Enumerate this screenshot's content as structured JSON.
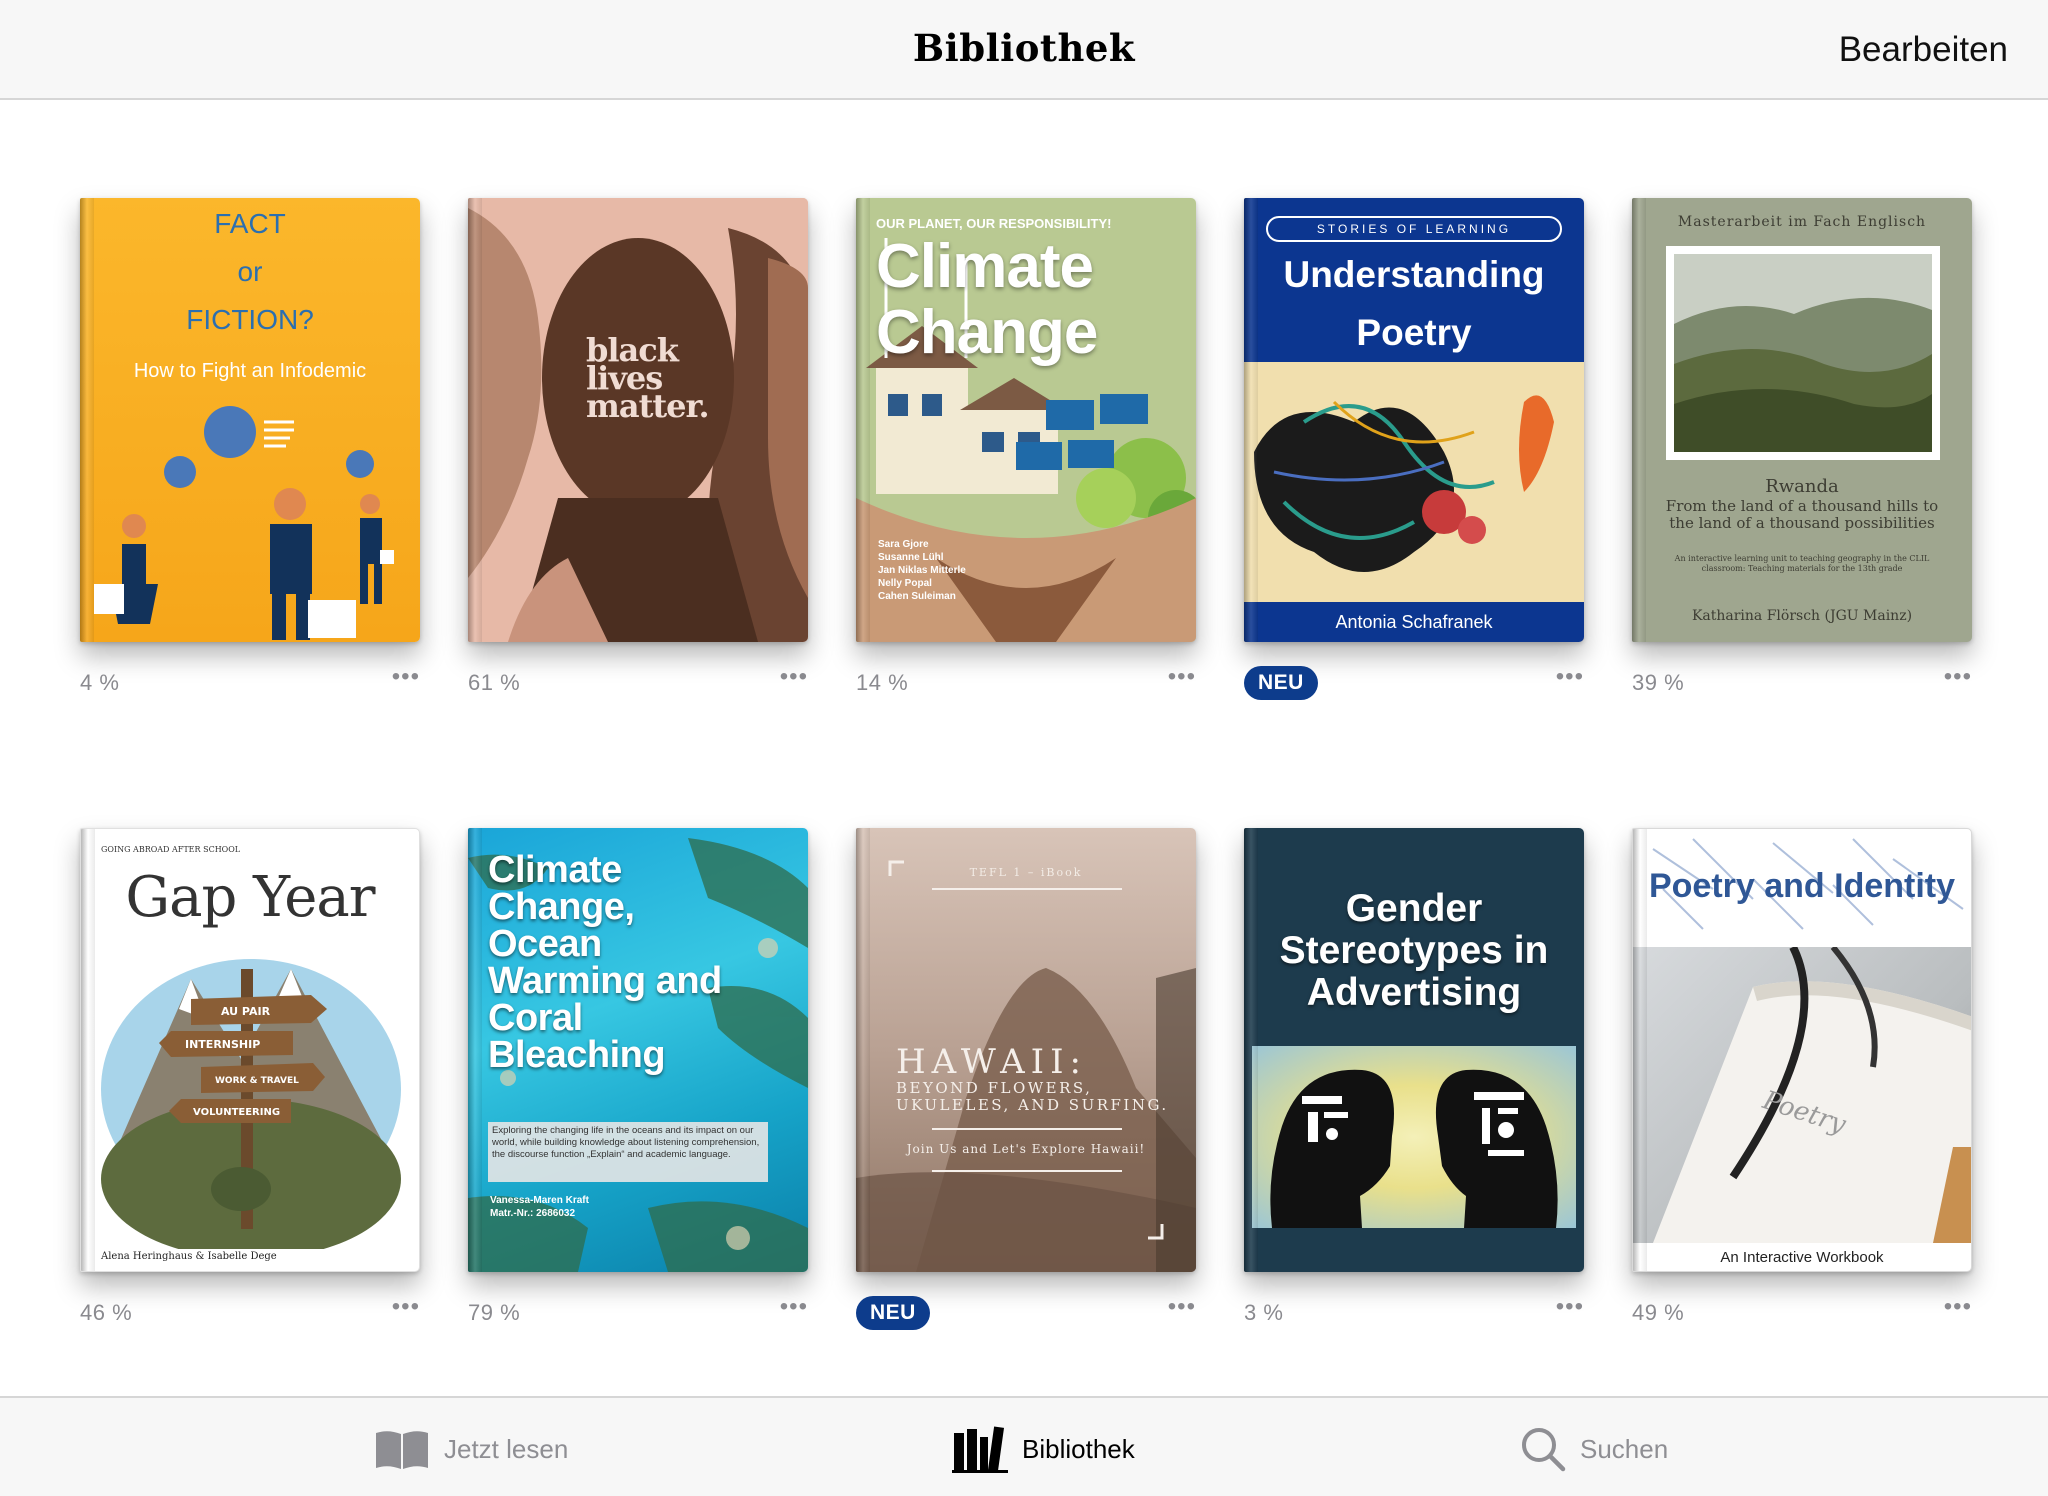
{
  "nav": {
    "title": "Bibliothek",
    "edit_label": "Bearbeiten"
  },
  "more_label": "•••",
  "books": [
    {
      "id": "fact-or-fiction",
      "progress": "4 %",
      "cover": {
        "title_lines": [
          "FACT",
          "or",
          "FICTION?"
        ],
        "subtitle": "How to Fight an Infodemic"
      }
    },
    {
      "id": "black-lives-matter",
      "progress": "61 %",
      "cover": {
        "title_lines": [
          "black",
          "lives",
          "matter."
        ]
      }
    },
    {
      "id": "climate-change",
      "progress": "14 %",
      "cover": {
        "kicker": "OUR PLANET, OUR RESPONSIBILITY!",
        "title_lines": [
          "Climate",
          "Change"
        ],
        "authors": [
          "Sara Gjore",
          "Susanne Lühl",
          "Jan Niklas Mitterle",
          "Nelly Popal",
          "Cahen Suleiman"
        ]
      }
    },
    {
      "id": "understanding-poetry",
      "badge": "NEU",
      "cover": {
        "kicker": "STORIES OF LEARNING",
        "title_lines": [
          "Understanding",
          "Poetry"
        ],
        "author": "Antonia Schafranek"
      }
    },
    {
      "id": "rwanda",
      "progress": "39 %",
      "cover": {
        "kicker": "Masterarbeit im Fach Englisch",
        "title": "Rwanda",
        "subtitle": "From the land of a thousand hills to the land of a thousand possibilities",
        "note": "An interactive learning unit to teaching geography in the CLIL classroom: Teaching materials for the 13th grade",
        "author": "Katharina Flörsch (JGU Mainz)"
      }
    },
    {
      "id": "gap-year",
      "progress": "46 %",
      "cover": {
        "kicker": "GOING ABROAD AFTER SCHOOL",
        "title": "Gap Year",
        "signs": [
          "AU PAIR",
          "INTERNSHIP",
          "WORK & TRAVEL",
          "VOLUNTEERING"
        ],
        "authors": "Alena Heringhaus & Isabelle Dege"
      }
    },
    {
      "id": "coral-bleaching",
      "progress": "79 %",
      "cover": {
        "title_lines": [
          "Climate",
          "Change,",
          "Ocean",
          "Warming and",
          "Coral",
          "Bleaching"
        ],
        "description": "Exploring the changing life in the oceans and its impact on our world, while building knowledge about listening comprehension, the discourse function „Explain“ and academic language.",
        "authors": [
          "Vanessa-Maren Kraft",
          "Matr.-Nr.: 2686032"
        ]
      }
    },
    {
      "id": "hawaii",
      "badge": "NEU",
      "cover": {
        "kicker": "TEFL 1 – iBook",
        "title": "HAWAII:",
        "subtitle_lines": [
          "BEYOND FLOWERS,",
          "UKULELES, AND SURFING."
        ],
        "cta": "Join Us and Let's Explore Hawaii!"
      }
    },
    {
      "id": "gender-stereotypes",
      "progress": "3 %",
      "cover": {
        "title_lines": [
          "Gender",
          "Stereotypes in",
          "Advertising"
        ]
      }
    },
    {
      "id": "poetry-identity",
      "progress": "49 %",
      "cover": {
        "title": "Poetry and Identity",
        "footer": "An Interactive Workbook",
        "handwriting": "Poetry"
      }
    }
  ],
  "tabs": [
    {
      "id": "reading-now",
      "label": "Jetzt lesen",
      "active": false
    },
    {
      "id": "library",
      "label": "Bibliothek",
      "active": true
    },
    {
      "id": "search",
      "label": "Suchen",
      "active": false
    }
  ]
}
